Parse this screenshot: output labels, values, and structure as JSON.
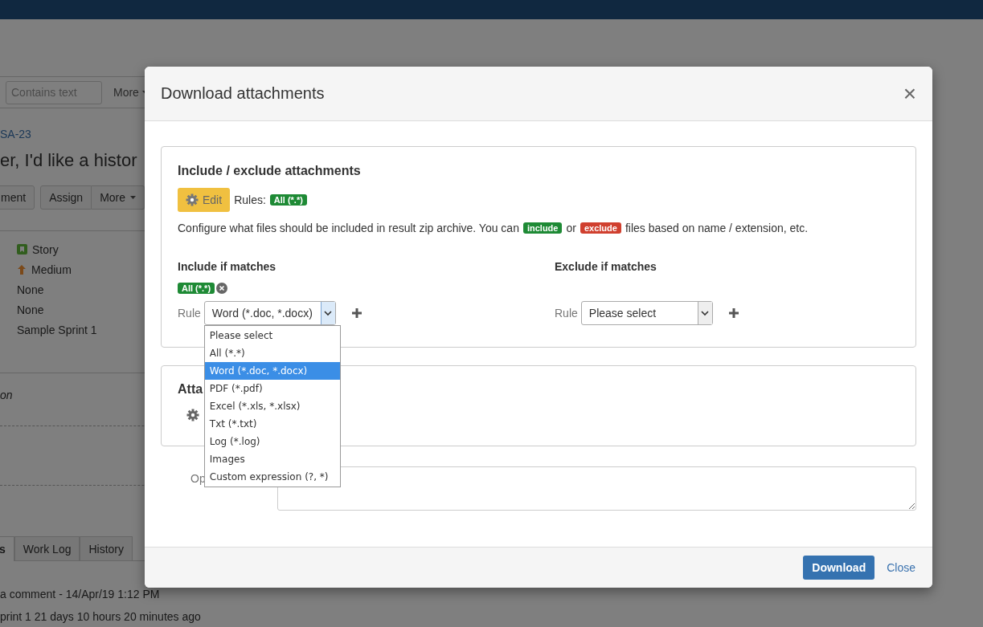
{
  "page": {
    "search": {
      "placeholder": "Contains text"
    },
    "more_menu": "More",
    "issue_key": "SA-23",
    "issue_title": "er, I'd like a histor",
    "actions": [
      "ment",
      "Assign",
      "More"
    ],
    "details": [
      {
        "kind": "story",
        "text": "Story"
      },
      {
        "kind": "priority",
        "text": "Medium"
      },
      {
        "kind": "plain",
        "text": "None"
      },
      {
        "kind": "plain",
        "text": "None"
      },
      {
        "kind": "plain",
        "text": "Sample Sprint 1"
      }
    ],
    "description_label": "on",
    "tabs": [
      {
        "label": "s",
        "selected": true
      },
      {
        "label": "Work Log",
        "selected": false
      },
      {
        "label": "History",
        "selected": false
      }
    ],
    "activity": [
      "a comment - 14/Apr/19 1:12 PM",
      "print 1 21 days 10 hours 20 minutes ago"
    ]
  },
  "dialog": {
    "title": "Download attachments",
    "close_icon": "×",
    "rules_panel": {
      "title": "Include / exclude attachments",
      "edit_button": "Edit",
      "rules_label": "Rules:",
      "rules_badge": "All (*.*)",
      "description": [
        {
          "kind": "text",
          "text": "Configure what files should be included in result zip archive. You can"
        },
        {
          "kind": "include",
          "text": "include"
        },
        {
          "kind": "text",
          "text": "or"
        },
        {
          "kind": "exclude",
          "text": "exclude"
        },
        {
          "kind": "text",
          "text": "files based on name / extension, etc."
        }
      ],
      "columns": [
        {
          "heading": "Include if matches",
          "rules": [
            {
              "text": "All (*.*)"
            }
          ],
          "rule_label": "Rule",
          "select": {
            "value": "Word (*.doc, *.docx)",
            "expanded": true,
            "options": [
              {
                "text": "Please select",
                "selected": false
              },
              {
                "text": "All (*.*)",
                "selected": false
              },
              {
                "text": "Word (*.doc, *.docx)",
                "selected": true
              },
              {
                "text": "PDF (*.pdf)",
                "selected": false
              },
              {
                "text": "Excel (*.xls, *.xlsx)",
                "selected": false
              },
              {
                "text": "Txt (*.txt)",
                "selected": false
              },
              {
                "text": "Log (*.log)",
                "selected": false
              },
              {
                "text": "Images",
                "selected": false
              },
              {
                "text": "Custom expression (?, *)",
                "selected": false
              }
            ]
          }
        },
        {
          "heading": "Exclude if matches",
          "rule_label": "Rule",
          "select": {
            "value": "Please select",
            "expanded": false
          }
        }
      ]
    },
    "attachments_panel": {
      "title": "Atta"
    },
    "options_label": "Op",
    "buttons": [
      {
        "kind": "primary",
        "text": "Download"
      },
      {
        "kind": "link",
        "text": "Close"
      }
    ]
  }
}
